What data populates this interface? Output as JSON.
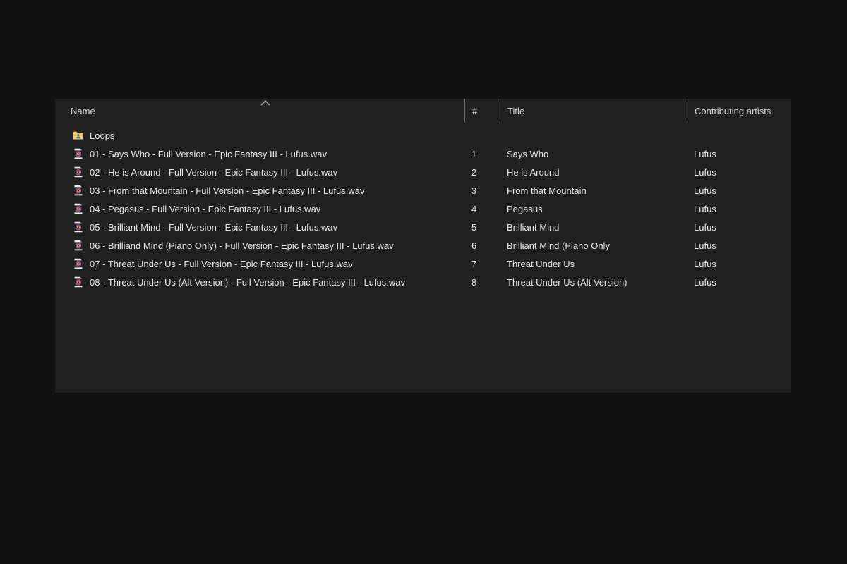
{
  "panel": {
    "background": "#202020",
    "page_background": "#111111",
    "separator_color": "#6e6e6e"
  },
  "columns": {
    "name": "Name",
    "number": "#",
    "title": "Title",
    "artists": "Contributing artists"
  },
  "sort": {
    "column": "Name",
    "direction": "ascending"
  },
  "folder": {
    "name": "Loops",
    "icon": "shared-folder-icon"
  },
  "files": [
    {
      "name": "01 - Says Who - Full Version - Epic Fantasy III - Lufus.wav",
      "num": "1",
      "title": "Says Who",
      "artist": "Lufus"
    },
    {
      "name": "02 - He is Around - Full Version - Epic Fantasy III - Lufus.wav",
      "num": "2",
      "title": "He is Around",
      "artist": "Lufus"
    },
    {
      "name": "03 - From that Mountain - Full Version - Epic Fantasy III - Lufus.wav",
      "num": "3",
      "title": "From that Mountain",
      "artist": "Lufus"
    },
    {
      "name": "04 - Pegasus - Full Version - Epic Fantasy III - Lufus.wav",
      "num": "4",
      "title": "Pegasus",
      "artist": "Lufus"
    },
    {
      "name": "05 - Brilliant Mind - Full Version - Epic Fantasy III - Lufus.wav",
      "num": "5",
      "title": "Brilliant Mind",
      "artist": "Lufus"
    },
    {
      "name": "06 - Brilliand Mind (Piano Only) - Full Version - Epic Fantasy III - Lufus.wav",
      "num": "6",
      "title": "Brilliant Mind (Piano Only",
      "artist": "Lufus"
    },
    {
      "name": "07 - Threat Under Us - Full Version - Epic Fantasy III - Lufus.wav",
      "num": "7",
      "title": "Threat Under Us",
      "artist": "Lufus"
    },
    {
      "name": "08 - Threat Under Us (Alt Version) - Full Version - Epic Fantasy III - Lufus.wav",
      "num": "8",
      "title": "Threat Under Us (Alt Version)",
      "artist": "Lufus"
    }
  ],
  "icon_colors": {
    "folder_yellow": "#e7c25e",
    "folder_person_blue": "#3e6fae",
    "file_page_white": "#f2f2f2",
    "file_square_dark": "#2a2230",
    "file_ring_purple": "#a855a2",
    "file_ring_orange": "#dd9a48"
  }
}
